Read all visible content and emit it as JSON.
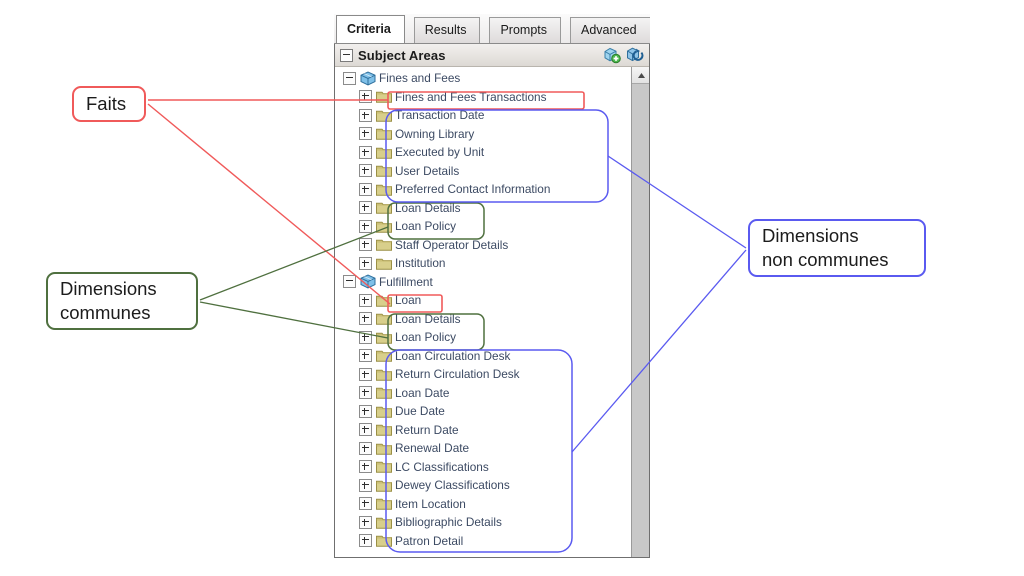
{
  "panel": {
    "tabs": [
      {
        "label": "Criteria",
        "active": true
      },
      {
        "label": "Results",
        "active": false
      },
      {
        "label": "Prompts",
        "active": false
      },
      {
        "label": "Advanced",
        "active": false
      }
    ],
    "subject_areas": {
      "title": "Subject Areas",
      "toggle_state": "expanded",
      "tools": [
        {
          "name": "add-subject-area-icon",
          "tooltip": "Add / Remove Subject Areas"
        },
        {
          "name": "refresh-subject-area-icon",
          "tooltip": "Refresh"
        }
      ]
    },
    "scrollbar": {
      "up_arrow": "˄"
    },
    "tree": [
      {
        "label": "Fines and Fees",
        "type": "subject-area",
        "state": "expanded",
        "level": 0,
        "highlight": "none"
      },
      {
        "label": "Fines and Fees Transactions",
        "type": "folder",
        "state": "collapsed",
        "level": 1,
        "highlight": "red"
      },
      {
        "label": "Transaction Date",
        "type": "folder",
        "state": "collapsed",
        "level": 1,
        "highlight": "blue"
      },
      {
        "label": "Owning Library",
        "type": "folder",
        "state": "collapsed",
        "level": 1,
        "highlight": "blue"
      },
      {
        "label": "Executed by Unit",
        "type": "folder",
        "state": "collapsed",
        "level": 1,
        "highlight": "blue"
      },
      {
        "label": "User Details",
        "type": "folder",
        "state": "collapsed",
        "level": 1,
        "highlight": "blue"
      },
      {
        "label": "Preferred Contact Information",
        "type": "folder",
        "state": "collapsed",
        "level": 1,
        "highlight": "blue"
      },
      {
        "label": "Loan Details",
        "type": "folder",
        "state": "collapsed",
        "level": 1,
        "highlight": "green"
      },
      {
        "label": "Loan Policy",
        "type": "folder",
        "state": "collapsed",
        "level": 1,
        "highlight": "green"
      },
      {
        "label": "Staff Operator Details",
        "type": "folder",
        "state": "collapsed",
        "level": 1,
        "highlight": "none"
      },
      {
        "label": "Institution",
        "type": "folder",
        "state": "collapsed",
        "level": 1,
        "highlight": "none"
      },
      {
        "label": "Fulfillment",
        "type": "subject-area",
        "state": "expanded",
        "level": 0,
        "highlight": "none"
      },
      {
        "label": "Loan",
        "type": "folder",
        "state": "collapsed",
        "level": 1,
        "highlight": "red"
      },
      {
        "label": "Loan Details",
        "type": "folder",
        "state": "collapsed",
        "level": 1,
        "highlight": "green"
      },
      {
        "label": "Loan Policy",
        "type": "folder",
        "state": "collapsed",
        "level": 1,
        "highlight": "green"
      },
      {
        "label": "Loan Circulation Desk",
        "type": "folder",
        "state": "collapsed",
        "level": 1,
        "highlight": "blue"
      },
      {
        "label": "Return Circulation Desk",
        "type": "folder",
        "state": "collapsed",
        "level": 1,
        "highlight": "blue"
      },
      {
        "label": "Loan Date",
        "type": "folder",
        "state": "collapsed",
        "level": 1,
        "highlight": "blue"
      },
      {
        "label": "Due Date",
        "type": "folder",
        "state": "collapsed",
        "level": 1,
        "highlight": "blue"
      },
      {
        "label": "Return Date",
        "type": "folder",
        "state": "collapsed",
        "level": 1,
        "highlight": "blue"
      },
      {
        "label": "Renewal Date",
        "type": "folder",
        "state": "collapsed",
        "level": 1,
        "highlight": "blue"
      },
      {
        "label": "LC Classifications",
        "type": "folder",
        "state": "collapsed",
        "level": 1,
        "highlight": "blue"
      },
      {
        "label": "Dewey Classifications",
        "type": "folder",
        "state": "collapsed",
        "level": 1,
        "highlight": "blue"
      },
      {
        "label": "Item Location",
        "type": "folder",
        "state": "collapsed",
        "level": 1,
        "highlight": "blue"
      },
      {
        "label": "Bibliographic Details",
        "type": "folder",
        "state": "collapsed",
        "level": 1,
        "highlight": "blue"
      },
      {
        "label": "Patron Detail",
        "type": "folder",
        "state": "collapsed",
        "level": 1,
        "highlight": "blue"
      }
    ]
  },
  "annotations": {
    "faits": {
      "line1": "Faits",
      "color": "#f05a5a"
    },
    "dimensions_communes": {
      "line1": "Dimensions",
      "line2": "communes",
      "color": "#4f703f"
    },
    "dimensions_non_communes": {
      "line1": "Dimensions",
      "line2": "non communes",
      "color": "#5a5af0"
    }
  },
  "colors": {
    "red": "#f05a5a",
    "green": "#4f703f",
    "blue": "#5a5af0",
    "tree_text": "#3c4a63",
    "folder": "#cfc682",
    "cube": "#4f96d8"
  }
}
